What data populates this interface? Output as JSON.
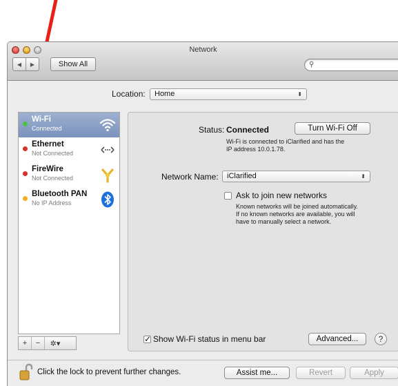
{
  "window": {
    "title": "Network"
  },
  "toolbar": {
    "back_glyph": "◀",
    "forward_glyph": "▶",
    "show_all_label": "Show All",
    "search_placeholder": "",
    "search_icon": "magnifier-icon"
  },
  "location": {
    "label": "Location:",
    "value": "Home"
  },
  "sidebar": {
    "services": [
      {
        "name": "Wi-Fi",
        "status": "Connected",
        "dot_color": "#4cc244",
        "icon": "wifi-icon",
        "selected": true
      },
      {
        "name": "Ethernet",
        "status": "Not Connected",
        "dot_color": "#d9302c",
        "icon": "ethernet-icon",
        "selected": false
      },
      {
        "name": "FireWire",
        "status": "Not Connected",
        "dot_color": "#d9302c",
        "icon": "firewire-icon",
        "selected": false
      },
      {
        "name": "Bluetooth PAN",
        "status": "No IP Address",
        "dot_color": "#f2b01e",
        "icon": "bluetooth-icon",
        "selected": false
      }
    ],
    "controls": {
      "add": "+",
      "remove": "−",
      "gear": "✲▾"
    }
  },
  "detail": {
    "status_label": "Status:",
    "status_value": "Connected",
    "turn_off_label": "Turn Wi-Fi Off",
    "status_desc_line1": "Wi-Fi is connected to iClarified and has the",
    "status_desc_line2": "IP address 10.0.1.78.",
    "network_name_label": "Network Name:",
    "network_name_value": "iClarified",
    "ask_join_label": "Ask to join new networks",
    "ask_join_checked": false,
    "ask_desc_line1": "Known networks will be joined automatically.",
    "ask_desc_line2": "If no known networks are available, you will",
    "ask_desc_line3": "have to manually select a network.",
    "show_status_label": "Show Wi-Fi status in menu bar",
    "show_status_checked": true,
    "advanced_label": "Advanced...",
    "help_label": "?"
  },
  "footer": {
    "lock_text": "Click the lock to prevent further changes.",
    "assist_label": "Assist me...",
    "revert_label": "Revert",
    "apply_label": "Apply"
  },
  "colors": {
    "arrow": "#e8201a",
    "selection": "#8aa0c6"
  }
}
